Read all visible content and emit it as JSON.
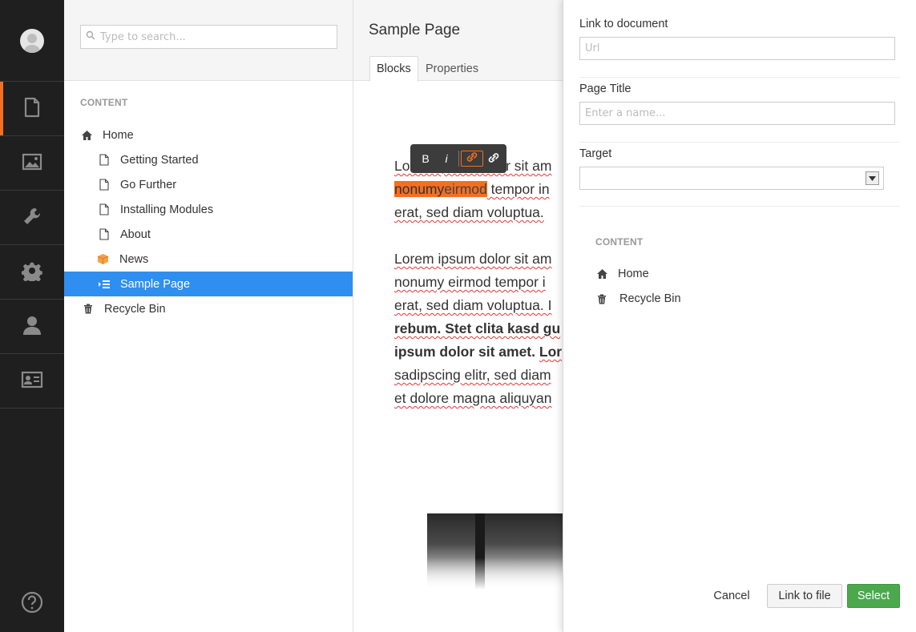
{
  "colors": {
    "accent": "#f36f21",
    "selection": "#2e8ff0",
    "success": "#4ca84c",
    "rail": "#1f1f1f"
  },
  "rail": {
    "items": [
      {
        "name": "content",
        "icon": "document-icon"
      },
      {
        "name": "media",
        "icon": "image-icon"
      },
      {
        "name": "settings",
        "icon": "wrench-icon"
      },
      {
        "name": "developer",
        "icon": "gear-icon"
      },
      {
        "name": "users",
        "icon": "user-icon"
      },
      {
        "name": "members",
        "icon": "id-card-icon"
      }
    ],
    "help_icon": "help-icon"
  },
  "tree": {
    "search_placeholder": "Type to search...",
    "section_label": "CONTENT",
    "items": [
      {
        "label": "Home",
        "icon": "home-icon"
      },
      {
        "label": "Getting Started",
        "icon": "page-icon"
      },
      {
        "label": "Go Further",
        "icon": "page-icon"
      },
      {
        "label": "Installing Modules",
        "icon": "page-icon"
      },
      {
        "label": "About",
        "icon": "page-icon"
      },
      {
        "label": "News",
        "icon": "box-icon"
      },
      {
        "label": "Sample Page",
        "icon": "list-icon",
        "selected": true
      },
      {
        "label": "Recycle Bin",
        "icon": "trash-icon"
      }
    ]
  },
  "editor": {
    "page_title": "Sample Page",
    "tabs": [
      {
        "label": "Blocks",
        "active": true
      },
      {
        "label": "Properties"
      }
    ],
    "toolbar": {
      "bold": "B",
      "italic": "i"
    },
    "paragraph1": {
      "line1": "Lorem ipsum dolor sit am",
      "line2_hl_a": "nonumy",
      "line2_hl_b": "eirmod",
      "line2_rest": " tempor in",
      "line3": "erat, sed diam voluptua."
    },
    "paragraph2": {
      "line1": "Lorem ipsum dolor sit am",
      "line2": "nonumy eirmod tempor i",
      "line3": "erat, sed diam voluptua. I",
      "line4": "rebum. Stet clita kasd gu",
      "line5a": "ipsum dolor sit amet. ",
      "line5b": "Lor",
      "line6": "sadipscing elitr, sed diam",
      "line7": "et dolore magna aliquyan"
    }
  },
  "dialog": {
    "link_label": "Link to document",
    "link_placeholder": "Url",
    "title_label": "Page Title",
    "title_placeholder": "Enter a name...",
    "target_label": "Target",
    "target_value": "",
    "section_label": "CONTENT",
    "tree": [
      {
        "label": "Home",
        "icon": "home-icon"
      },
      {
        "label": "Recycle Bin",
        "icon": "trash-icon"
      }
    ],
    "buttons": {
      "cancel": "Cancel",
      "link_file": "Link to file",
      "select": "Select"
    }
  }
}
